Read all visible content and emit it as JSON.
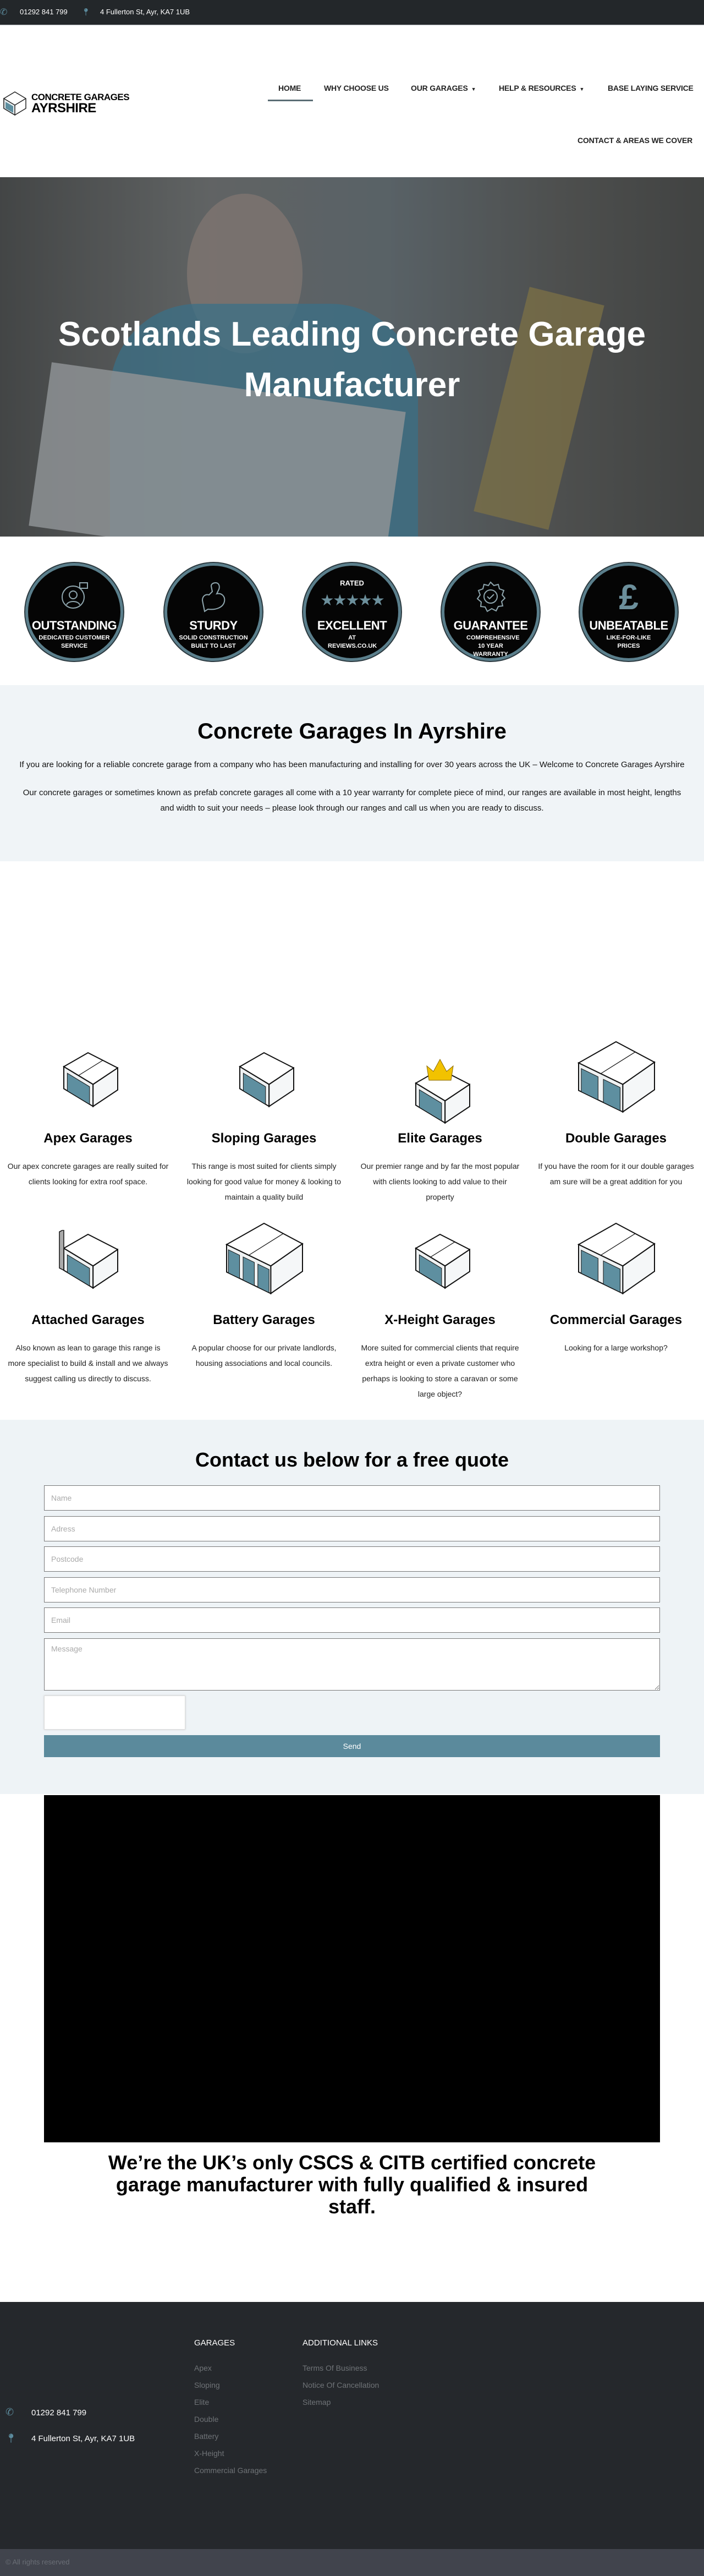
{
  "topbar": {
    "phone": "01292 841 799",
    "address": "4 Fullerton St, Ayr, KA7 1UB"
  },
  "logo": {
    "line1": "CONCRETE GARAGES",
    "line2": "AYRSHIRE"
  },
  "nav": {
    "items": [
      {
        "label": "HOME",
        "active": true
      },
      {
        "label": "WHY CHOOSE US"
      },
      {
        "label": "OUR GARAGES",
        "dropdown": true
      },
      {
        "label": "HELP & RESOURCES",
        "dropdown": true
      },
      {
        "label": "BASE LAYING SERVICE"
      },
      {
        "label": "CONTACT & AREAS WE COVER"
      }
    ]
  },
  "hero": {
    "title": "Scotlands Leading Concrete Garage Manufacturer"
  },
  "badges": [
    {
      "icon": "customer-service-icon",
      "top": "",
      "big": "OUTSTANDING",
      "small": "DEDICATED CUSTOMER SERVICE"
    },
    {
      "icon": "flexed-arm-icon",
      "top": "",
      "big": "STURDY",
      "small": "SOLID CONSTRUCTION BUILT TO LAST"
    },
    {
      "icon": "five-stars-icon",
      "top": "RATED",
      "big": "EXCELLENT",
      "small": "AT REVIEWS.CO.UK"
    },
    {
      "icon": "guarantee-seal-icon",
      "top": "",
      "big": "GUARANTEE",
      "small": "COMPREHENSIVE 10 YEAR WARRANTY"
    },
    {
      "icon": "pound-sign-icon",
      "top": "",
      "big": "UNBEATABLE",
      "small": "LIKE-FOR-LIKE PRICES"
    }
  ],
  "intro": {
    "title": "Concrete Garages In Ayrshire",
    "p1": "If you are looking for a reliable concrete garage from a company who has been manufacturing and installing for over 30 years across the UK – Welcome to Concrete Garages Ayrshire",
    "p2": "Our concrete garages or sometimes known as prefab concrete garages all come with a 10 year warranty for complete piece of mind, our ranges are available in most height, lengths and width to suit your needs – please look through our ranges and call us when you are ready to discuss."
  },
  "garages": [
    {
      "title": "Apex Garages",
      "desc": "Our apex concrete garages are really suited for clients looking for extra roof space."
    },
    {
      "title": "Sloping Garages",
      "desc": "This range is most suited for clients simply looking for good value for money & looking to maintain a quality build"
    },
    {
      "title": "Elite Garages",
      "desc": "Our premier range and by far the most popular with clients looking to add value to their property"
    },
    {
      "title": "Double Garages",
      "desc": "If you have the room for it our double garages am sure will be a great addition for you"
    },
    {
      "title": "Attached Garages",
      "desc": "Also known as lean to garage this range is more specialist to build & install and we always suggest calling us directly to discuss."
    },
    {
      "title": "Battery Garages",
      "desc": "A popular choose for our private landlords, housing associations and local councils."
    },
    {
      "title": "X-Height Garages",
      "desc": "More suited for commercial clients that require extra height or even a private customer who perhaps is looking to store a caravan or some large object?"
    },
    {
      "title": "Commercial Garages",
      "desc": "Looking for a large workshop?"
    }
  ],
  "contact": {
    "title": "Contact us below for a free quote",
    "fields": {
      "name": "Name",
      "address": "Adress",
      "postcode": "Postcode",
      "telephone": "Telephone Number",
      "email": "Email",
      "message": "Message"
    },
    "send_label": "Send"
  },
  "cscs": {
    "text": "We’re the UK’s only CSCS & CITB certified concrete garage manufacturer with fully qualified & insured staff."
  },
  "footer": {
    "phone": "01292 841 799",
    "address": "4 Fullerton St, Ayr, KA7 1UB",
    "garages_heading": "GARAGES",
    "garages_links": [
      "Apex",
      "Sloping",
      "Elite",
      "Double",
      "Battery",
      "X-Height",
      "Commercial Garages"
    ],
    "additional_heading": "ADDITIONAL LINKS",
    "additional_links": [
      "Terms Of Business",
      "Notice Of Cancellation",
      "Sitemap"
    ],
    "copyright": "© All rights reserved"
  },
  "colors": {
    "accent": "#5b8a9c",
    "topbar": "#23272a",
    "footer": "#25282c",
    "section_bg": "#f0f4f7",
    "garage_door": "#5e8fa0",
    "crown": "#f2c200"
  }
}
